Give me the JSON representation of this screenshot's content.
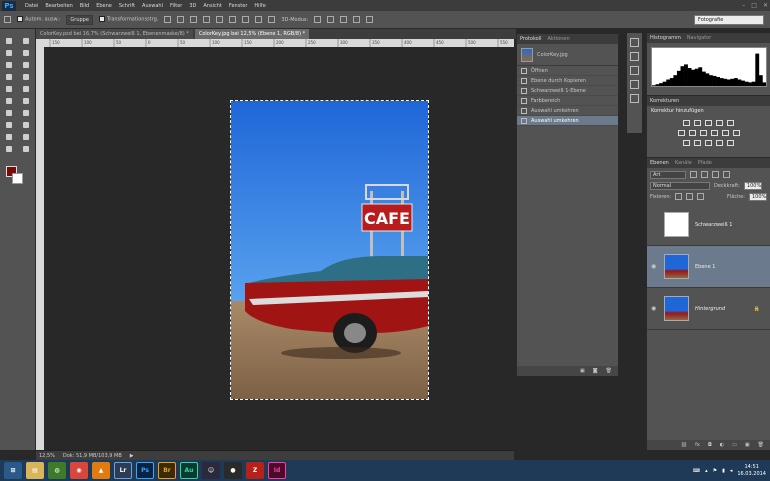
{
  "menubar": {
    "app_logo": "Ps",
    "items": [
      "Datei",
      "Bearbeiten",
      "Bild",
      "Ebene",
      "Schrift",
      "Auswahl",
      "Filter",
      "3D",
      "Ansicht",
      "Fenster",
      "Hilfe"
    ],
    "window_controls": [
      "–",
      "□",
      "✕"
    ]
  },
  "options_bar": {
    "auto_select_label": "Autom. ausw.:",
    "auto_select_value": "Gruppe",
    "transform_label": "Transformationsstrg.",
    "mode_3d_label": "3D-Modus:",
    "workspace": "Fotografie"
  },
  "tabs": [
    {
      "label": "ColorKey.psd bei 16,7% (Schwarzweiß 1, Ebenenmaske/8) *",
      "active": false
    },
    {
      "label": "ColorKey.jpg bei 12,5% (Ebene 1, RGB/8) *",
      "active": true
    }
  ],
  "ruler_ticks": [
    "150",
    "100",
    "50",
    "0",
    "50",
    "100",
    "150",
    "200",
    "250",
    "300",
    "350",
    "400",
    "450",
    "500",
    "550"
  ],
  "status_bar": {
    "zoom": "12,5%",
    "doc_info": "Dok: 51,9 MB/103,9 MB"
  },
  "colors": {
    "foreground": "#7a0b0b",
    "background": "#ffffff",
    "selection": "#6b7a8c",
    "taskbar": "#1f3a57"
  },
  "protokoll_panel": {
    "tabs": [
      "Protokoll",
      "Aktionen"
    ],
    "snapshot": "ColorKey.jpg",
    "items": [
      {
        "label": "Öffnen",
        "selected": false
      },
      {
        "label": "Ebene durch Kopieren",
        "selected": false
      },
      {
        "label": "Schwarzweiß 1-Ebene",
        "selected": false
      },
      {
        "label": "Farbbereich",
        "selected": false
      },
      {
        "label": "Auswahl umkehren",
        "selected": false
      },
      {
        "label": "Auswahl umkehren",
        "selected": true
      }
    ]
  },
  "histogram_panel": {
    "tabs": [
      "Histogramm",
      "Navigator"
    ],
    "bins": [
      0.02,
      0.05,
      0.08,
      0.12,
      0.18,
      0.22,
      0.3,
      0.42,
      0.55,
      0.6,
      0.5,
      0.45,
      0.48,
      0.52,
      0.4,
      0.35,
      0.3,
      0.28,
      0.25,
      0.22,
      0.2,
      0.18,
      0.2,
      0.22,
      0.18,
      0.15,
      0.12,
      0.1,
      0.12,
      0.9,
      0.3,
      0.1
    ]
  },
  "adjustments_panel": {
    "tab": "Korrekturen",
    "title": "Korrektur hinzufügen"
  },
  "layers_panel": {
    "tabs": [
      "Ebenen",
      "Kanäle",
      "Pfade"
    ],
    "filter": "Art",
    "blend_mode": "Normal",
    "opacity_label": "Deckkraft:",
    "opacity": "100%",
    "lock_label": "Fixieren:",
    "fill_label": "Fläche:",
    "fill": "100%",
    "layers": [
      {
        "name": "Schwarzweiß 1",
        "visible": false,
        "selected": false,
        "type": "adjustment"
      },
      {
        "name": "Ebene 1",
        "visible": true,
        "selected": true,
        "type": "pixel"
      },
      {
        "name": "Hintergrund",
        "visible": true,
        "selected": false,
        "type": "background"
      }
    ]
  },
  "photo": {
    "sign_text": "CAFE"
  },
  "taskbar": {
    "apps": [
      "Lr",
      "Ps",
      "Br",
      "Au",
      "Id"
    ],
    "tray_icons": [
      "keyboard-icon",
      "chevron-up-icon",
      "flag-icon",
      "network-icon",
      "volume-icon",
      "battery-icon"
    ],
    "time": "14:51",
    "date": "16.03.2014"
  }
}
